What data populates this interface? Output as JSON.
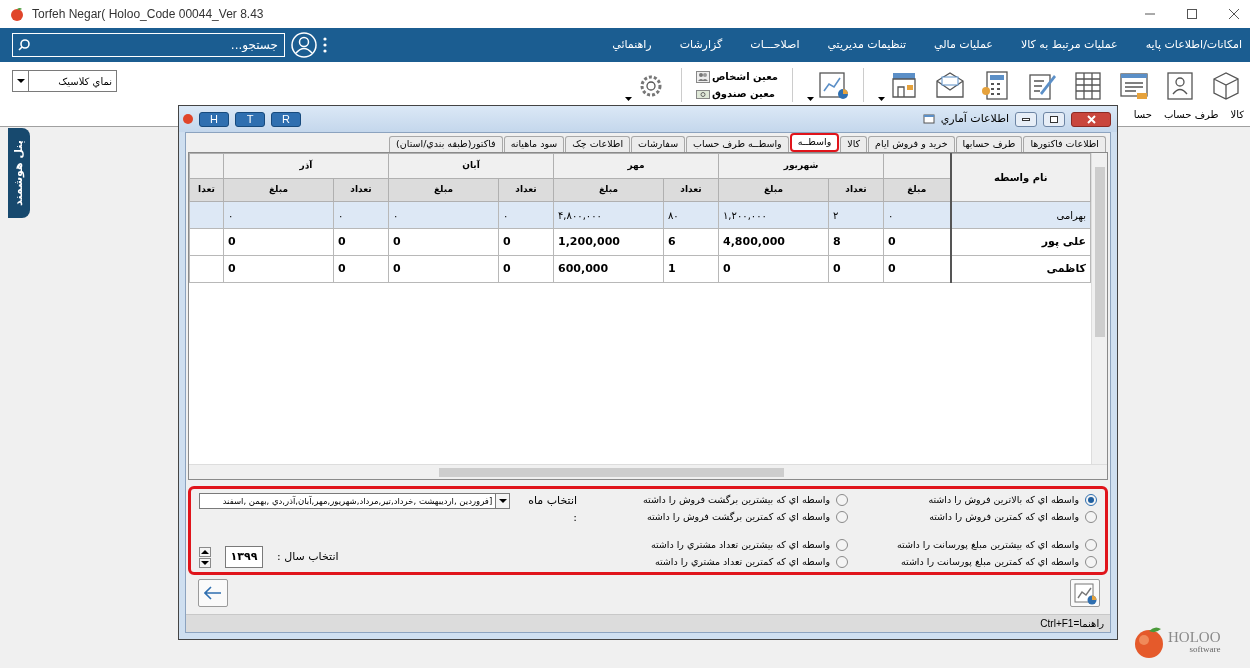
{
  "app_window": {
    "title": "Torfeh Negar( Holoo_Code 00044_Ver 8.43"
  },
  "menu_bar": {
    "search": {
      "placeholder": "جستجو..."
    },
    "items": [
      "امکانات/اطلاعات پایه",
      "عملیات مرتبط به کالا",
      "عملیات مالي",
      "تنظیمات مدیریتي",
      "اصلاحـــات",
      "گزارشات",
      "راهنمائي"
    ]
  },
  "toolbar": {
    "view_select": {
      "value": "نماي كلاسيک"
    },
    "captions": [
      "کالا",
      "طرف حساب",
      "حسا"
    ],
    "ledger_links": [
      "معین اشخاص",
      "معین صندوق"
    ]
  },
  "side_panel": {
    "label": "پنل هوشمند"
  },
  "dialog": {
    "title": "اطلاعات آماري",
    "quick_buttons": [
      "R",
      "T",
      "H"
    ],
    "tabs": [
      {
        "label": "اطلاعات فاکتورها",
        "selected": false,
        "highlighted": false
      },
      {
        "label": "طرف حسابها",
        "selected": false,
        "highlighted": false
      },
      {
        "label": "خرید و فروش ایام",
        "selected": false,
        "highlighted": false
      },
      {
        "label": "کالا",
        "selected": false,
        "highlighted": false
      },
      {
        "label": "واسطــه",
        "selected": true,
        "highlighted": true
      },
      {
        "label": "واسطــه طرف حساب",
        "selected": false,
        "highlighted": false
      },
      {
        "label": "سفارشات",
        "selected": false,
        "highlighted": false
      },
      {
        "label": "اطلاعات چک",
        "selected": false,
        "highlighted": false
      },
      {
        "label": "سود ماهیانه",
        "selected": false,
        "highlighted": false
      },
      {
        "label": "فاکتور(طبقه بندي/استان)",
        "selected": false,
        "highlighted": false
      }
    ],
    "table": {
      "columns": [
        {
          "kind": "single",
          "label": "نام واسطه"
        },
        {
          "kind": "partial",
          "label": "مبلغ"
        },
        {
          "kind": "group",
          "label": "شهریور",
          "colspan": 2,
          "children": [
            "تعداد",
            "مبلغ"
          ]
        },
        {
          "kind": "group",
          "label": "مهر",
          "colspan": 2,
          "children": [
            "تعداد",
            "مبلغ"
          ]
        },
        {
          "kind": "group",
          "label": "آبان",
          "colspan": 2,
          "children": [
            "تعداد",
            "مبلغ"
          ]
        },
        {
          "kind": "group",
          "label": "آذر",
          "colspan": 2,
          "children": [
            "تعداد",
            "مبلغ"
          ]
        },
        {
          "kind": "partial",
          "label": "تعدا"
        }
      ],
      "rows": [
        {
          "selected": true,
          "cells": [
            "بهرامی",
            "۰",
            "۲",
            "۱,۲۰۰,۰۰۰",
            "۸۰",
            "۴,۸۰۰,۰۰۰",
            "۰",
            "۰",
            "۰",
            "۰"
          ]
        },
        {
          "selected": false,
          "cells": [
            "علی پور",
            "0",
            "8",
            "4,800,000",
            "6",
            "1,200,000",
            "0",
            "0",
            "0",
            "0"
          ]
        },
        {
          "selected": false,
          "cells": [
            "کاظمی",
            "0",
            "0",
            "0",
            "1",
            "600,000",
            "0",
            "0",
            "0",
            "0"
          ]
        }
      ]
    },
    "options_panel": {
      "highlighted": true,
      "options": [
        {
          "label": "واسطه اي كه بالاترين فروش را داشته",
          "selected": true
        },
        {
          "label": "واسطه اي كه بيشترين برگشت فروش را داشته",
          "selected": false
        },
        {
          "label": "واسطه اي كه كمترين فروش را داشته",
          "selected": false
        },
        {
          "label": "واسطه اي كه كمترين برگشت فروش را داشته",
          "selected": false
        },
        {
          "label": "واسطه اي كه بيشترين مبلغ پورسانت را داشته",
          "selected": false
        },
        {
          "label": "واسطه اي كه بيشترين تعداد مشتري را داشته",
          "selected": false
        },
        {
          "label": "واسطه اي كه كمترين مبلغ پورسانت را داشته",
          "selected": false
        },
        {
          "label": "واسطه اي كه كمترين تعداد مشتري را داشته",
          "selected": false
        }
      ],
      "month": {
        "label": "انتخاب ماه :",
        "value": "[فروردین ,اردیبهشت ,خرداد,تیر,مرداد,شهریور,مهر,آبان,آذر,دي  ,بهمن ,اسفند"
      },
      "year": {
        "label": "انتخاب سال :",
        "value": "۱۳۹۹"
      }
    },
    "status_text": "راهنما=Ctrl+F1"
  },
  "logo": {
    "name": "HOLOO",
    "tagline": "software"
  }
}
